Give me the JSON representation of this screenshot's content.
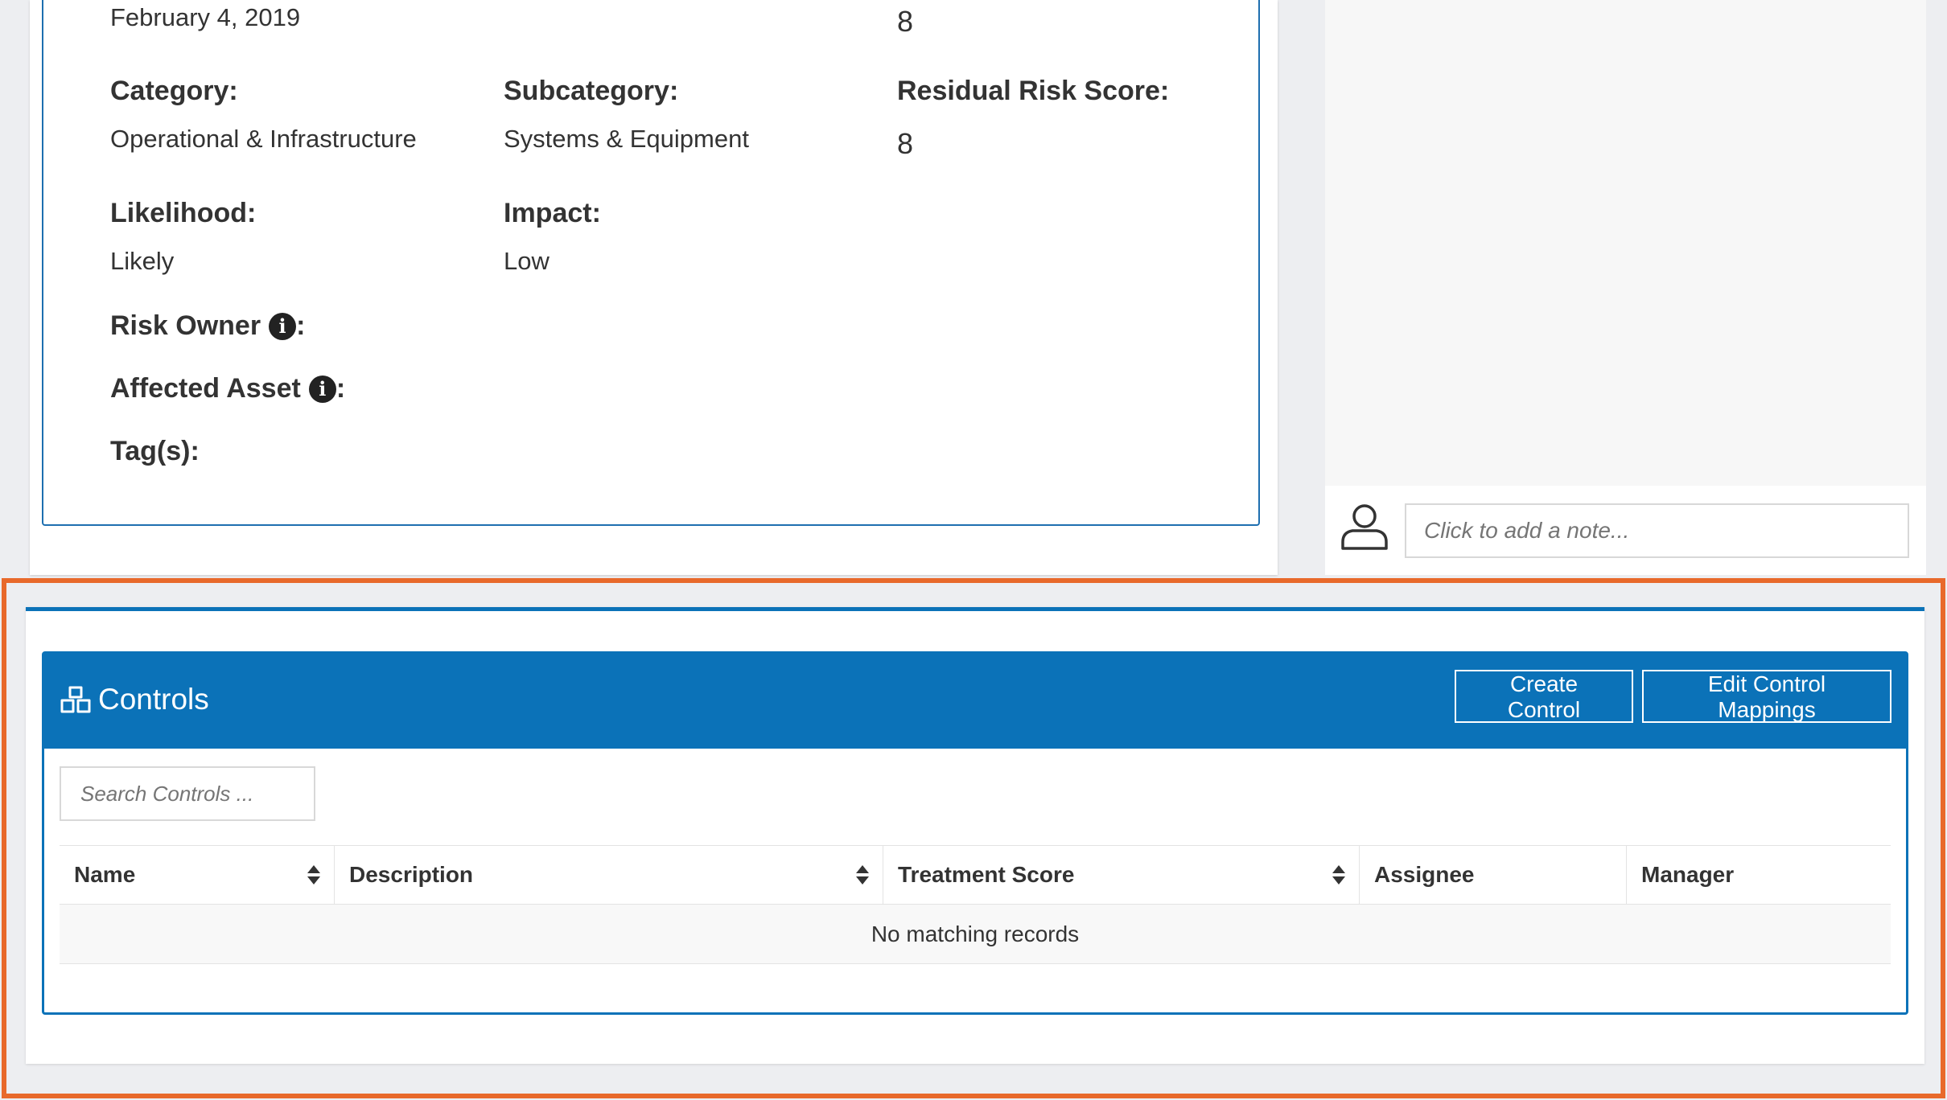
{
  "details": {
    "date_value": "February 4, 2019",
    "top_score_value": "8",
    "category_label": "Category:",
    "category_value": "Operational & Infrastructure",
    "subcategory_label": "Subcategory:",
    "subcategory_value": "Systems & Equipment",
    "residual_label": "Residual Risk Score:",
    "residual_value": "8",
    "likelihood_label": "Likelihood:",
    "likelihood_value": "Likely",
    "impact_label": "Impact:",
    "impact_value": "Low",
    "risk_owner_label": "Risk Owner",
    "affected_asset_label": "Affected Asset",
    "tags_label": "Tag(s):",
    "colon": ":",
    "info_glyph": "i"
  },
  "notes": {
    "placeholder": "Click to add a note...",
    "icon": "user-icon"
  },
  "controls": {
    "title": "Controls",
    "icon": "cubes-icon",
    "create_button": "Create Control",
    "edit_button": "Edit Control Mappings",
    "search_placeholder": "Search Controls ...",
    "columns": [
      "Name",
      "Description",
      "Treatment Score",
      "Assignee",
      "Manager"
    ],
    "empty_message": "No matching records"
  },
  "colors": {
    "accent": "#0b72b8",
    "highlight": "#e8692b"
  }
}
